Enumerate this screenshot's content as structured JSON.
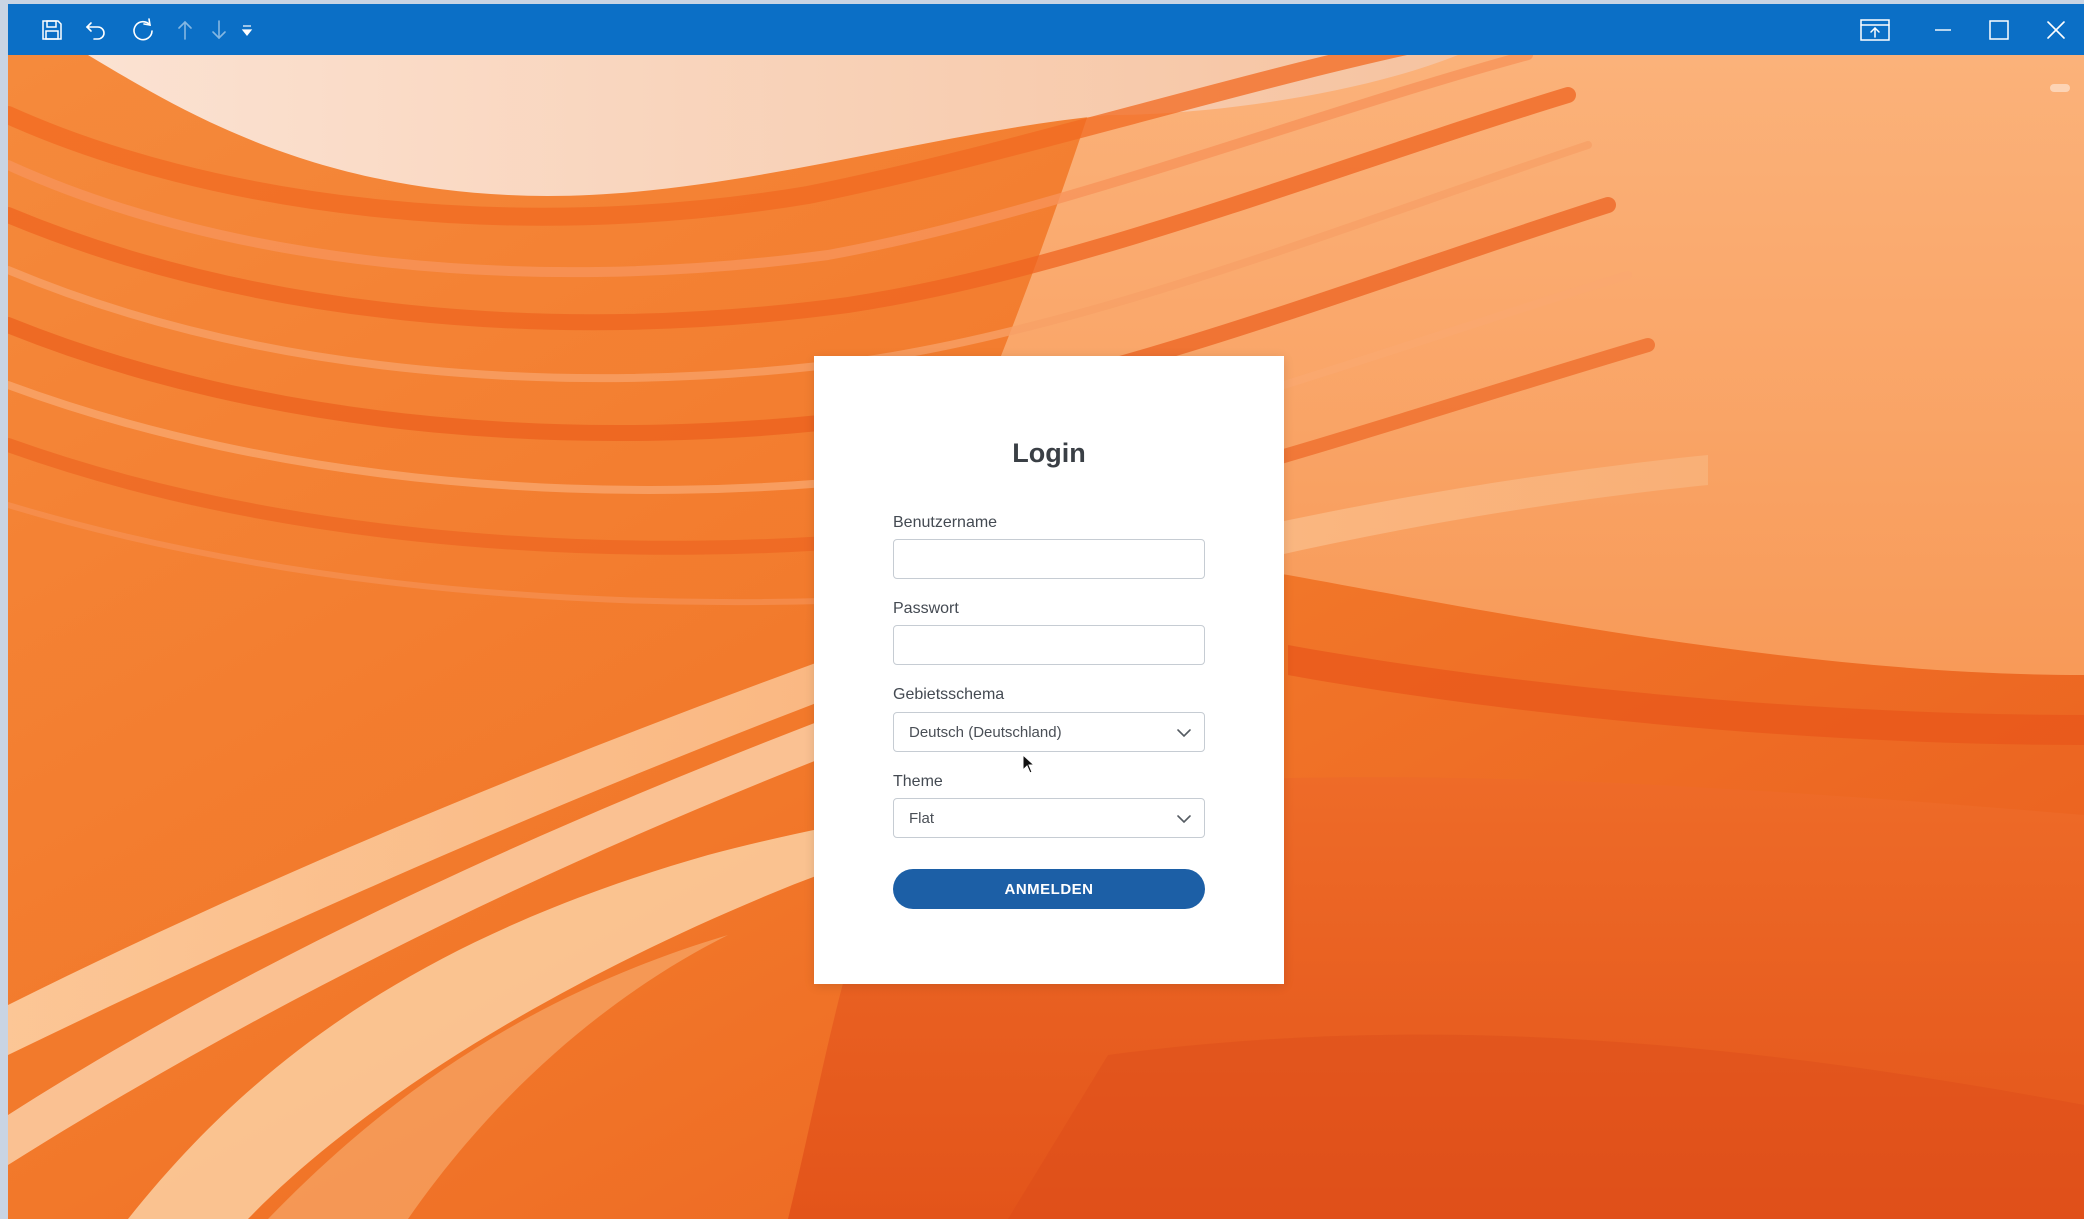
{
  "toolbar": {
    "icons": [
      "save-icon",
      "undo-icon",
      "redo-icon",
      "arrow-up-icon",
      "arrow-down-icon",
      "customize-dropdown-icon"
    ],
    "window_controls": [
      "present-icon",
      "minimize-icon",
      "maximize-icon",
      "close-icon"
    ]
  },
  "colors": {
    "titlebar": "#0b6fc6",
    "button": "#1c5fa6",
    "card": "#ffffff",
    "wallpaper_accent": "#f07a2c"
  },
  "login": {
    "title": "Login",
    "username_label": "Benutzername",
    "username_value": "",
    "password_label": "Passwort",
    "password_value": "",
    "locale_label": "Gebietsschema",
    "locale_value": "Deutsch (Deutschland)",
    "theme_label": "Theme",
    "theme_value": "Flat",
    "submit_label": "ANMELDEN"
  }
}
